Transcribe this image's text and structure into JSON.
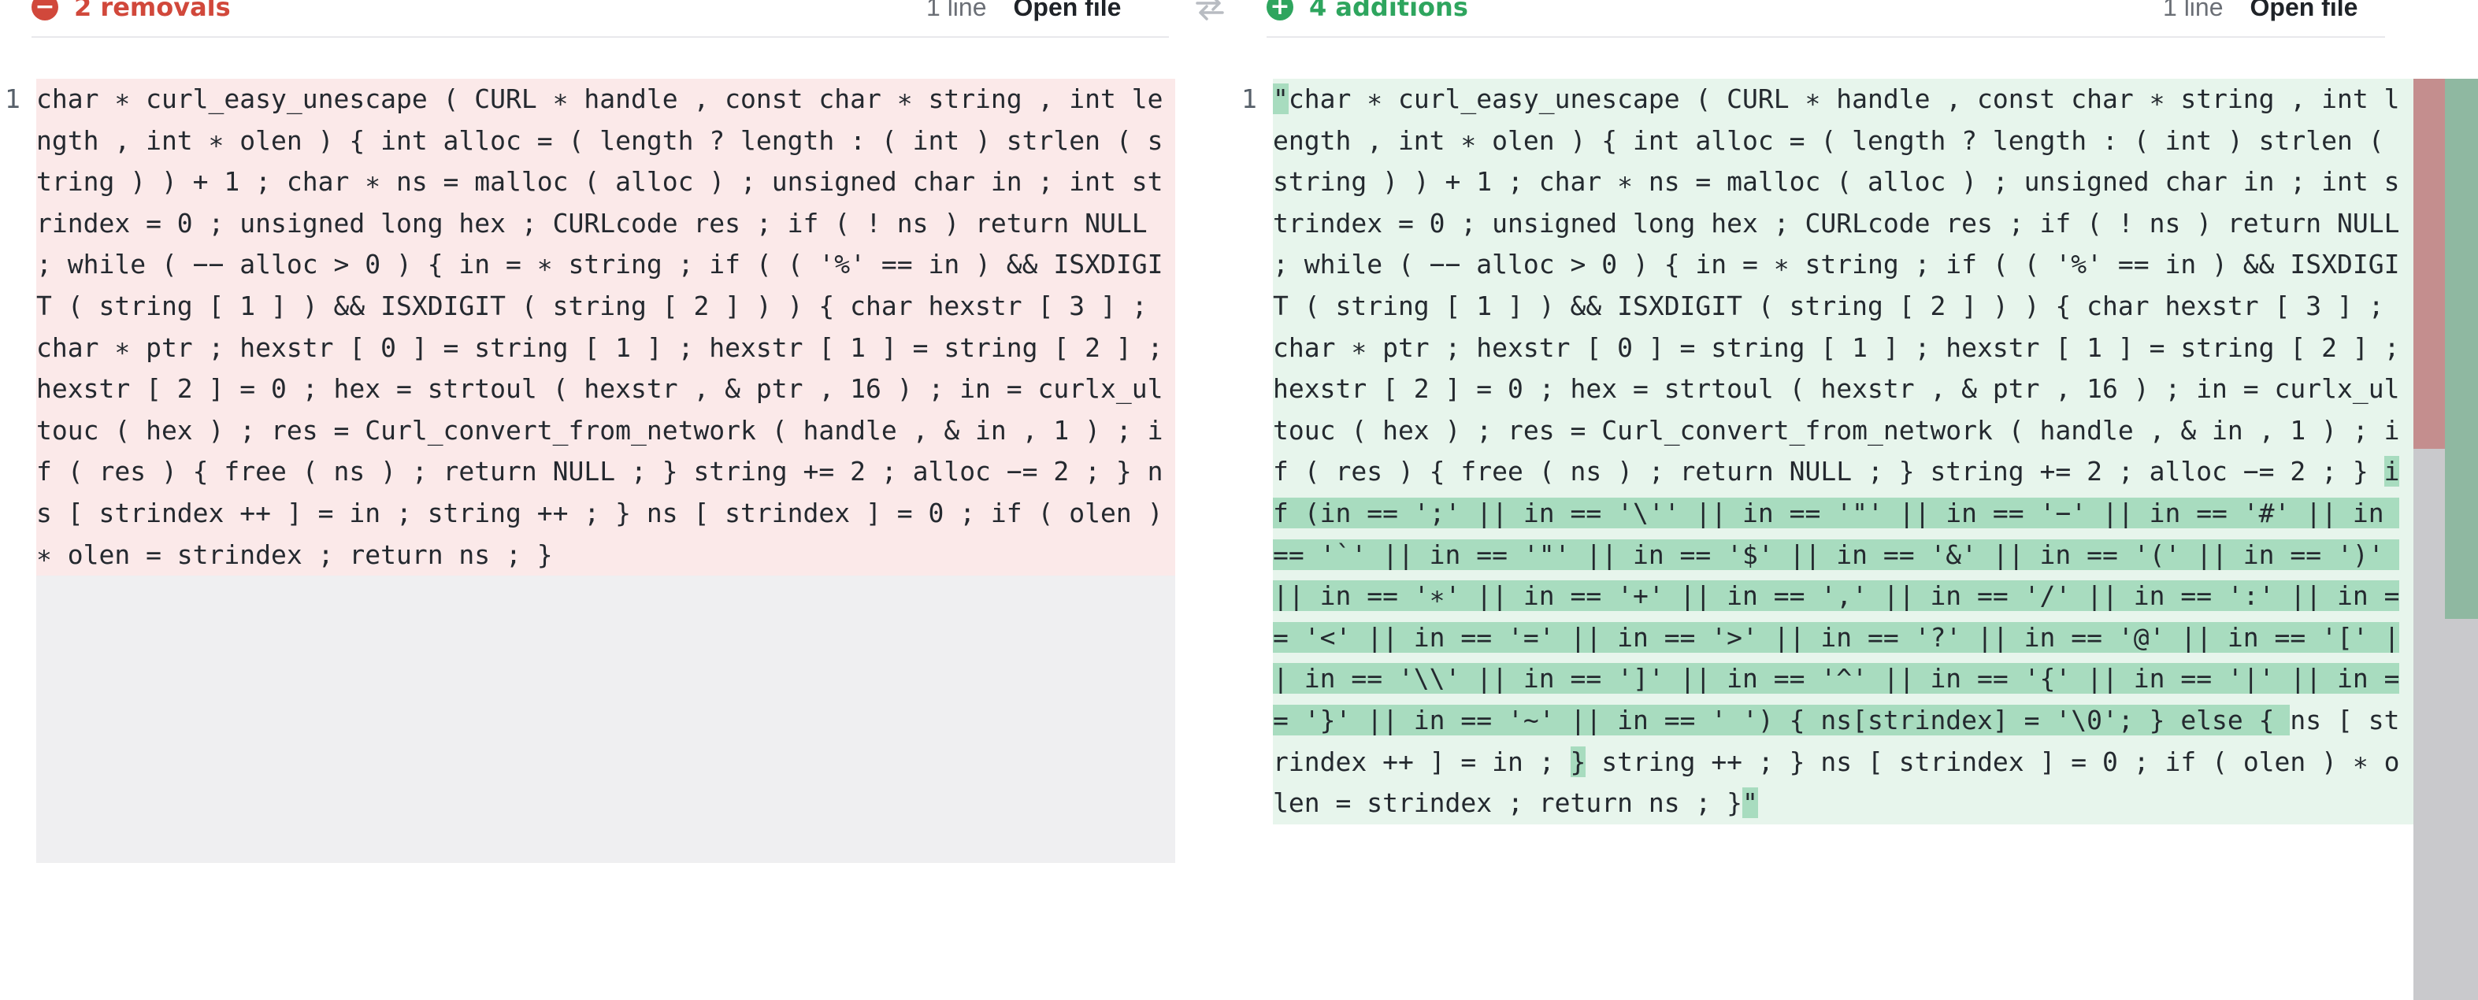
{
  "left_header": {
    "icon": "minus-circle-icon",
    "label": "2 removals",
    "lines": "1 line",
    "open": "Open file",
    "color": "#d1483b"
  },
  "right_header": {
    "icon": "plus-circle-icon",
    "label": "4 additions",
    "lines": "1 line",
    "open": "Open file",
    "color": "#2ea55e"
  },
  "swap_icon": "swap-arrows-icon",
  "left_pane": {
    "line_number": "1",
    "bg": "#fbe9e9",
    "code": "char ∗ curl_easy_unescape ( CURL ∗ handle , const char ∗ string , int length , int ∗ olen ) { int alloc = ( length ? length : ( int ) strlen ( string ) ) + 1 ; char ∗ ns = malloc ( alloc ) ; unsigned char in ; int strindex = 0 ; unsigned long hex ; CURLcode res ; if ( ! ns ) return NULL ; while ( −− alloc > 0 ) { in = ∗ string ; if ( ( '%' == in ) && ISXDIGIT ( string [ 1 ] ) && ISXDIGIT ( string [ 2 ] ) ) { char hexstr [ 3 ] ; char ∗ ptr ; hexstr [ 0 ] = string [ 1 ] ; hexstr [ 1 ] = string [ 2 ] ; hexstr [ 2 ] = 0 ; hex = strtoul ( hexstr , & ptr , 16 ) ; in = curlx_ultouc ( hex ) ; res = Curl_convert_from_network ( handle , & in , 1 ) ; if ( res ) { free ( ns ) ; return NULL ; } string += 2 ; alloc −= 2 ; } ns [ strindex ++ ] = in ; string ++ ; } ns [ strindex ] = 0 ; if ( olen ) ∗ olen = strindex ; return ns ; }"
  },
  "right_pane": {
    "line_number": "1",
    "bg": "#e7f5ec",
    "segments": [
      {
        "text": "\"",
        "added": true
      },
      {
        "text": "char ∗ curl_easy_unescape ( CURL ∗ handle , const char ∗ string , int length , int ∗ olen ) { int alloc = ( length ? length : ( int ) strlen ( string ) ) + 1 ; char ∗ ns = malloc ( alloc ) ; unsigned char in ; int strindex = 0 ; unsigned long hex ; CURLcode res ; if ( ! ns ) return NULL ; while ( −− alloc > 0 ) { in = ∗ string ; if ( ( '%' == in ) && ISXDIGIT ( string [ 1 ] ) && ISXDIGIT ( string [ 2 ] ) ) { char hexstr [ 3 ] ; char ∗ ptr ; hexstr [ 0 ] = string [ 1 ] ; hexstr [ 1 ] = string [ 2 ] ; hexstr [ 2 ] = 0 ; hex = strtoul ( hexstr , & ptr , 16 ) ; in = curlx_ultouc ( hex ) ; res = Curl_convert_from_network ( handle , & in , 1 ) ; if ( res ) { free ( ns ) ; return NULL ; } string += 2 ; alloc −= 2 ; } ",
        "added": false
      },
      {
        "text": "if (in == ';' || in == '\\'' || in == '\"' || in == '−' || in == '#' || in == '`' || in == '\"' || in == '$' || in == '&' || in == '(' || in == ')' || in == '∗' || in == '+' || in == ',' || in == '/' || in == ':' || in == '<' || in == '=' || in == '>' || in == '?' || in == '@' || in == '[' || in == '\\\\' || in == ']' || in == '^' || in == '{' || in == '|' || in == '}' || in == '~' || in == ' ') { ns[strindex] = '\\0'; } else { ",
        "added": true
      },
      {
        "text": "ns [ strindex ++ ] = in ; ",
        "added": false
      },
      {
        "text": "}",
        "added": true
      },
      {
        "text": " string ++ ; } ns [ strindex ] = 0 ; if ( olen ) ∗ olen = strindex ; return ns ; }",
        "added": false
      },
      {
        "text": "\"",
        "added": true
      }
    ]
  },
  "scrollbar": {
    "track_color": "#c9c9cc",
    "removed_color": "#c48e8e",
    "added_color": "#8fb8a1"
  }
}
